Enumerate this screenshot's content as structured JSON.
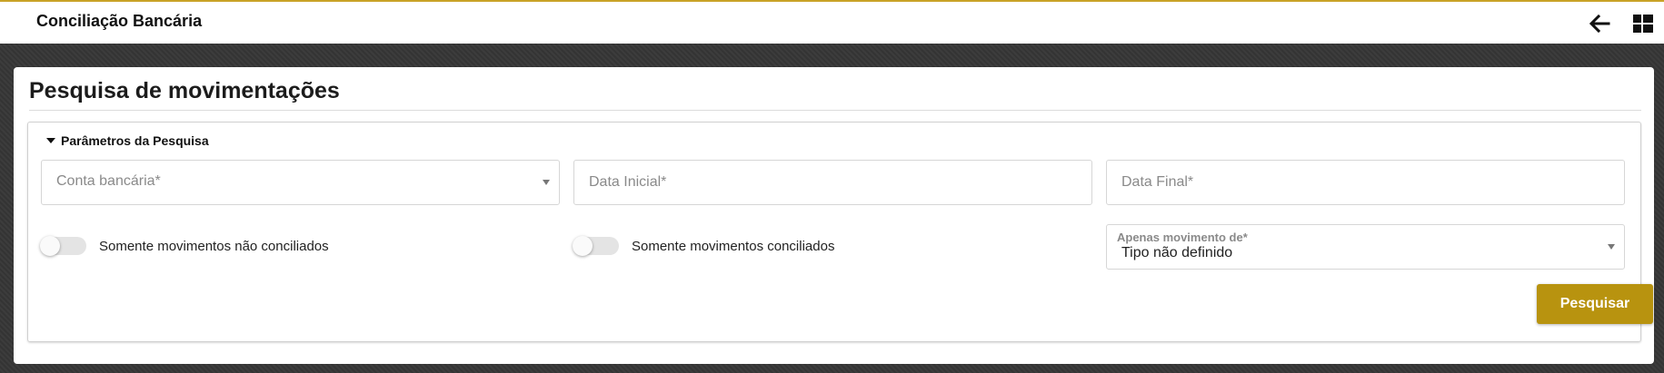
{
  "header": {
    "title": "Conciliação Bancária",
    "back_icon": "arrow-left-icon",
    "menu_icon": "grid-layout-icon",
    "accent_color": "#c9a227"
  },
  "page": {
    "title": "Pesquisa de movimentações"
  },
  "search_params": {
    "legend": "Parâmetros da Pesquisa",
    "conta_bancaria": {
      "placeholder": "Conta bancária*",
      "value": ""
    },
    "data_inicial": {
      "placeholder": "Data Inicial*",
      "value": ""
    },
    "data_final": {
      "placeholder": "Data Final*",
      "value": ""
    },
    "toggle_nao_conciliados": {
      "label": "Somente movimentos não conciliados",
      "checked": false
    },
    "toggle_conciliados": {
      "label": "Somente movimentos conciliados",
      "checked": false
    },
    "apenas_movimento": {
      "label": "Apenas movimento de*",
      "value": "Tipo não definido"
    },
    "search_button": "Pesquisar",
    "button_color": "#b8930f"
  }
}
